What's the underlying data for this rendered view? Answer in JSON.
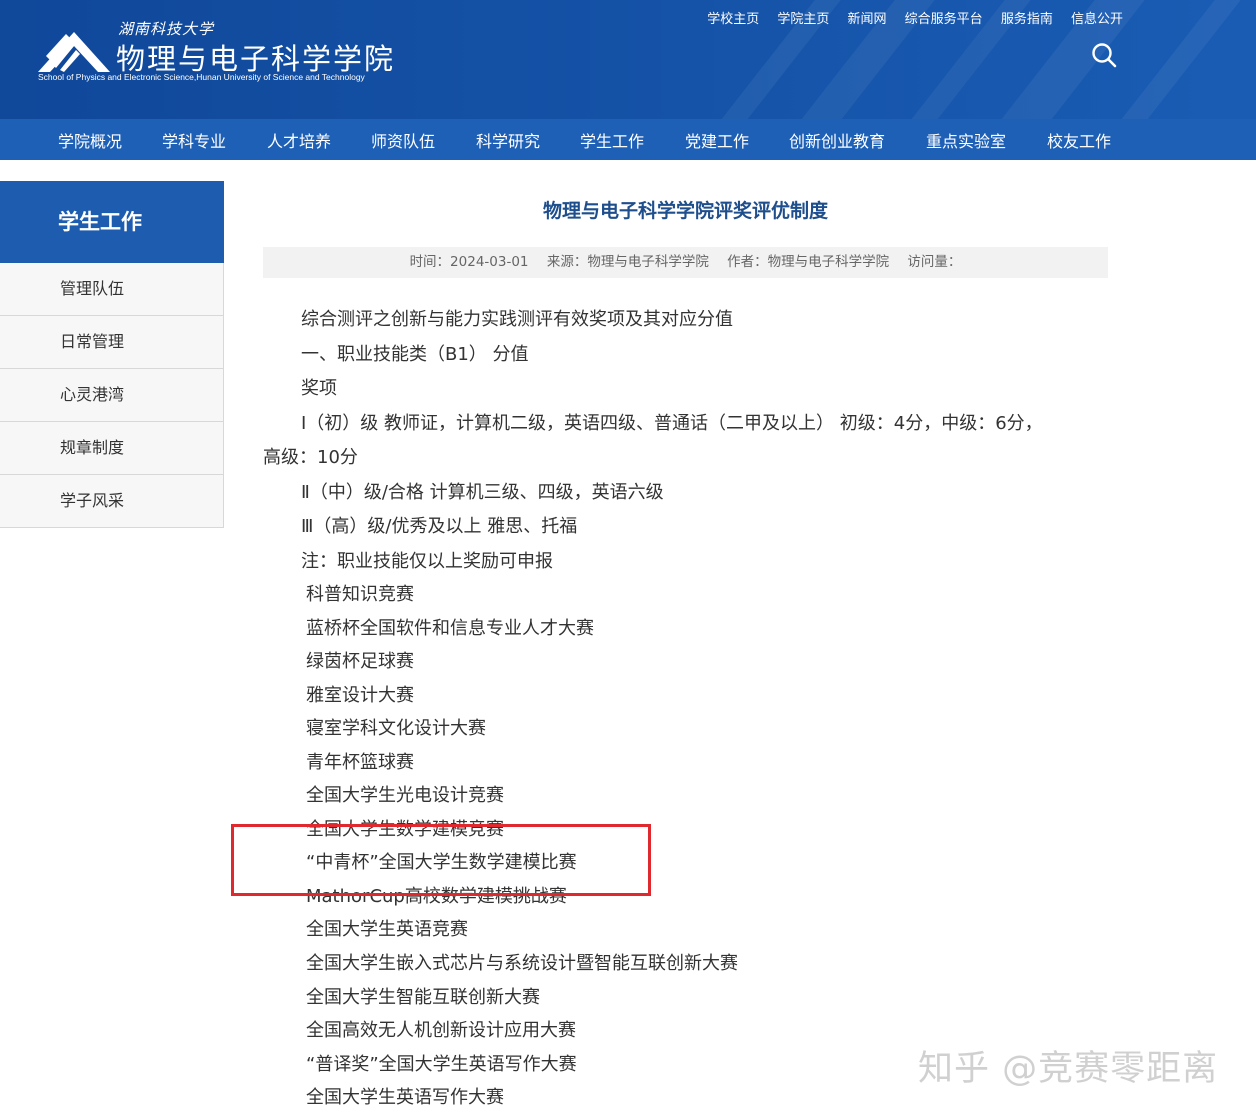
{
  "header": {
    "univ_name": "湖南科技大学",
    "college_name": "物理与电子科学学院",
    "college_name_en": "School of Physics and Electronic Science,Hunan University of Science and Technology",
    "top_links": [
      "学校主页",
      "学院主页",
      "新闻网",
      "综合服务平台",
      "服务指南",
      "信息公开"
    ]
  },
  "nav": {
    "items": [
      "学院概况",
      "学科专业",
      "人才培养",
      "师资队伍",
      "科学研究",
      "学生工作",
      "党建工作",
      "创新创业教育",
      "重点实验室",
      "校友工作"
    ]
  },
  "sidebar": {
    "title": "学生工作",
    "items": [
      "管理队伍",
      "日常管理",
      "心灵港湾",
      "规章制度",
      "学子风采"
    ]
  },
  "article": {
    "title": "物理与电子科学学院评奖评优制度",
    "meta": {
      "time": "时间：2024-03-01",
      "source": "来源：物理与电子科学学院",
      "author": "作者：物理与电子科学学院",
      "views": "访问量："
    },
    "paragraphs": [
      "综合测评之创新与能力实践测评有效奖项及其对应分值",
      "一、职业技能类（B1）  分值",
      "奖项",
      "Ⅰ（初）级 教师证，计算机二级，英语四级、普通话（二甲及以上） 初级：4分，中级：6分，",
      "高级：10分",
      "Ⅱ（中）级/合格 计算机三级、四级，英语六级",
      "Ⅲ（高）级/优秀及以上 雅思、托福",
      "注：职业技能仅以上奖励可申报"
    ],
    "competitions": [
      "科普知识竞赛",
      "蓝桥杯全国软件和信息专业人才大赛",
      "绿茵杯足球赛",
      "雅室设计大赛",
      "寝室学科文化设计大赛",
      "青年杯篮球赛",
      "全国大学生光电设计竞赛",
      "全国大学生数学建模竞赛",
      "“中青杯”全国大学生数学建模比赛",
      "MathorCup高校数学建模挑战赛",
      "全国大学生英语竞赛",
      "全国大学生嵌入式芯片与系统设计暨智能互联创新大赛",
      "全国大学生智能互联创新大赛",
      "全国高效无人机创新设计应用大赛",
      "“普译奖”全国大学生英语写作大赛",
      "全国大学生英语写作大赛"
    ]
  },
  "watermark": "知乎 @竞赛零距离",
  "colors": {
    "header_bg": "#1553a8",
    "nav_bg": "#1e60b6",
    "sidebar_title_bg": "#1e5cb0",
    "title_color": "#1e4e8c",
    "highlight_box": "#e0282f"
  }
}
